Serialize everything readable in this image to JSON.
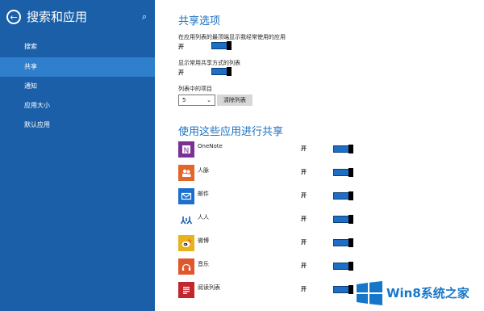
{
  "sidebar": {
    "title": "搜索和应用",
    "items": [
      {
        "label": "搜索"
      },
      {
        "label": "共享"
      },
      {
        "label": "通知"
      },
      {
        "label": "应用大小"
      },
      {
        "label": "默认应用"
      }
    ],
    "active_index": 1,
    "bg_color": "#1a5fa8",
    "active_color": "#2f7fcd"
  },
  "share": {
    "heading": "共享选项",
    "opt1_label": "在应用列表的最顶端显示我经常使用的应用",
    "opt1_value": "开",
    "opt2_label": "显示常用共享方式的列表",
    "opt2_value": "开",
    "list_label": "列表中的项目",
    "list_count": "5",
    "clear_button": "清除列表"
  },
  "apps_heading": "使用这些应用进行共享",
  "apps": [
    {
      "name": "OneNote",
      "value": "开",
      "icon": "onenote-icon",
      "color": "#7b3194"
    },
    {
      "name": "人脉",
      "value": "开",
      "icon": "people-icon",
      "color": "#e3662b"
    },
    {
      "name": "邮件",
      "value": "开",
      "icon": "mail-icon",
      "color": "#1d6fcf"
    },
    {
      "name": "人人",
      "value": "开",
      "icon": "renren-icon",
      "color": "#1d5ea8"
    },
    {
      "name": "微博",
      "value": "开",
      "icon": "weibo-icon",
      "color": "#e8b21d"
    },
    {
      "name": "音乐",
      "value": "开",
      "icon": "music-icon",
      "color": "#e0572b"
    },
    {
      "name": "阅读列表",
      "value": "开",
      "icon": "reading-list-icon",
      "color": "#c4262e"
    }
  ],
  "watermark": {
    "text": "Win8系统之家"
  },
  "colors": {
    "accent": "#1c6fbf",
    "toggle_on": "#1e6ec5"
  }
}
